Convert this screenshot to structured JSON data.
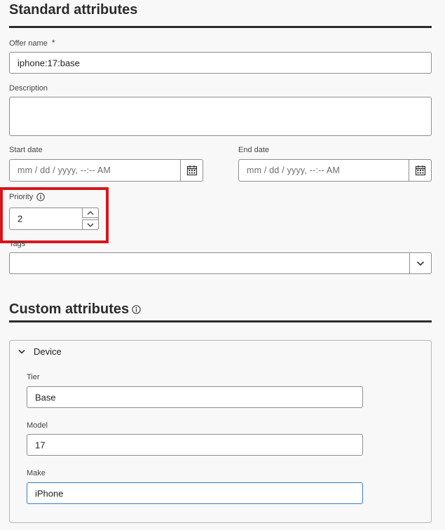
{
  "standard": {
    "heading": "Standard attributes",
    "offer_name": {
      "label": "Offer name",
      "required_mark": "*",
      "value": "iphone:17:base"
    },
    "description": {
      "label": "Description",
      "value": ""
    },
    "start_date": {
      "label": "Start date",
      "placeholder": "mm / dd / yyyy, --:-- AM",
      "icon": "calendar-icon"
    },
    "end_date": {
      "label": "End date",
      "placeholder": "mm / dd / yyyy, --:-- AM",
      "icon": "calendar-icon"
    },
    "priority": {
      "label": "Priority",
      "value": "2",
      "info_icon": "info-icon"
    },
    "tags": {
      "label": "Tags",
      "value": "",
      "icon": "chevron-down-icon"
    }
  },
  "custom": {
    "heading": "Custom attributes",
    "info_icon": "info-icon",
    "group": {
      "label": "Device",
      "expanded": true,
      "fields": [
        {
          "label": "Tier",
          "value": "Base"
        },
        {
          "label": "Model",
          "value": "17"
        },
        {
          "label": "Make",
          "value": "iPhone"
        }
      ]
    }
  },
  "colors": {
    "highlight": "#d7171b",
    "focus": "#3a7bc8",
    "text": "#2c2c2c"
  }
}
